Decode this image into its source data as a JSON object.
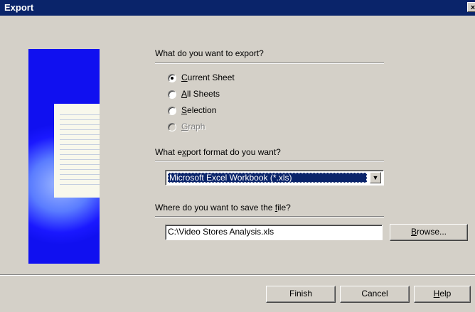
{
  "window": {
    "title": "Export",
    "close_glyph": "×"
  },
  "section_what": {
    "question": "What do you want to export?",
    "options": [
      {
        "mnemonic": "C",
        "rest": "urrent Sheet",
        "selected": true,
        "enabled": true
      },
      {
        "mnemonic": "A",
        "rest": "ll Sheets",
        "selected": false,
        "enabled": true
      },
      {
        "mnemonic": "S",
        "rest": "election",
        "selected": false,
        "enabled": true
      },
      {
        "mnemonic": "G",
        "rest": "raph",
        "selected": false,
        "enabled": false
      }
    ]
  },
  "section_format": {
    "q_before": "What e",
    "q_mnemonic": "x",
    "q_after": "port format do you want?",
    "selected_value": "Microsoft Excel Workbook (*.xls)"
  },
  "section_save": {
    "q_before": "Where do you want to save the ",
    "q_mnemonic": "f",
    "q_after": "ile?",
    "path_value": "C:\\Video Stores Analysis.xls",
    "browse_mnemonic": "B",
    "browse_rest": "rowse..."
  },
  "buttons": {
    "finish": "Finish",
    "cancel": "Cancel",
    "help_mnemonic": "H",
    "help_rest": "elp"
  },
  "icons": {
    "dropdown_arrow": "▼",
    "close": "close-icon",
    "wizard_art": "document-illustration"
  }
}
